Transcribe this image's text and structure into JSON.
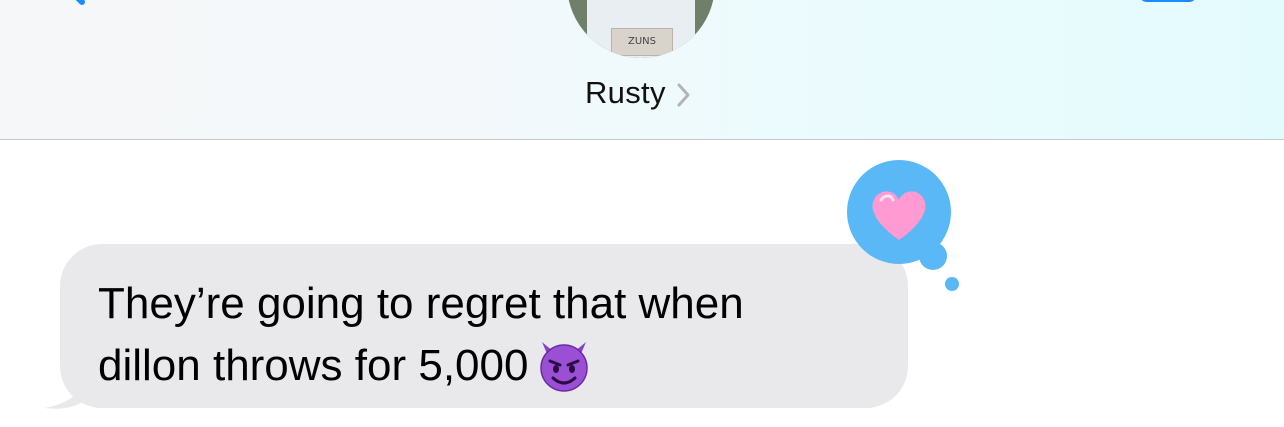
{
  "header": {
    "contact_name": "Rusty",
    "avatar_sign_text": "ZUNS",
    "back_icon": "chevron-left-icon",
    "video_icon": "video-camera-icon",
    "disclosure_icon": "chevron-right-icon"
  },
  "messages": [
    {
      "direction": "received",
      "lines": [
        "They’re going to regret that when",
        "dillon throws for 5,000"
      ],
      "emoji": "smiling-face-with-horns-icon",
      "tapback": "heart-icon"
    }
  ],
  "colors": {
    "ios_blue": "#1a8cff",
    "tapback_blue": "#5ab8f6",
    "bubble_gray": "#e9e9eb",
    "heart_pink": "#ff9ad2",
    "emoji_purple": "#8a3fc7"
  }
}
